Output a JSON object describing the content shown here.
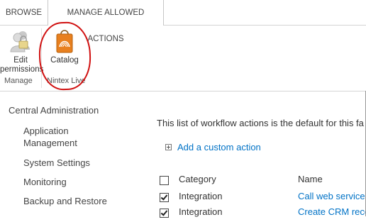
{
  "ribbon": {
    "tabs": [
      {
        "label": "BROWSE"
      },
      {
        "label": "MANAGE ALLOWED ACTIONS"
      }
    ],
    "buttons": {
      "edit_permissions": "Edit\npermissions",
      "catalog": "Catalog"
    },
    "groups": {
      "manage": "Manage",
      "nintex_live": "Nintex Live"
    }
  },
  "quicklaunch": {
    "heading": "Central Administration",
    "items": [
      {
        "label": "Application Management"
      },
      {
        "label": "System Settings"
      },
      {
        "label": "Monitoring"
      },
      {
        "label": "Backup and Restore"
      }
    ]
  },
  "main": {
    "description": "This list of workflow actions is the default for this fa",
    "add_action": "Add a custom action"
  },
  "table": {
    "headers": {
      "category": "Category",
      "name": "Name"
    },
    "rows": [
      {
        "category": "Integration",
        "name": "Call web service",
        "checked": true
      },
      {
        "category": "Integration",
        "name": "Create CRM reco",
        "checked": true
      }
    ]
  },
  "colors": {
    "link": "#0072c6",
    "annotation": "#d01010",
    "catalog_icon": "#e8801f"
  }
}
